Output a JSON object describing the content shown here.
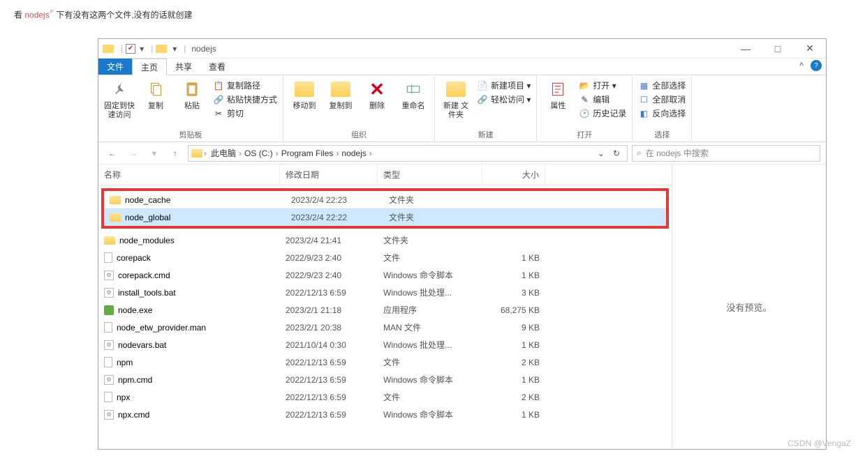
{
  "intro": {
    "pre": "看 ",
    "hl": "nodejs",
    "post": " 下有没有这两个文件,没有的话就创建"
  },
  "title": "nodejs",
  "win_controls": {
    "min": "—",
    "max": "□",
    "close": "✕"
  },
  "menubar": {
    "file": "文件",
    "home": "主页",
    "share": "共享",
    "view": "查看",
    "help": "?",
    "collapse": "^"
  },
  "ribbon": {
    "clipboard": {
      "label": "剪贴板",
      "pin": "固定到快\n速访问",
      "copy": "复制",
      "paste": "粘贴",
      "copypath": "复制路径",
      "shortcut": "粘贴快捷方式",
      "cut": "剪切"
    },
    "organize": {
      "label": "组织",
      "moveto": "移动到",
      "copyto": "复制到",
      "delete": "删除",
      "rename": "重命名"
    },
    "new": {
      "label": "新建",
      "newfolder": "新建\n文件夹",
      "newitem": "新建项目 ▾",
      "easyaccess": "轻松访问 ▾"
    },
    "open": {
      "label": "打开",
      "props": "属性",
      "open": "打开 ▾",
      "edit": "编辑",
      "history": "历史记录"
    },
    "select": {
      "label": "选择",
      "all": "全部选择",
      "none": "全部取消",
      "invert": "反向选择"
    }
  },
  "address": {
    "crumbs": [
      "此电脑",
      "OS (C:)",
      "Program Files",
      "nodejs"
    ]
  },
  "search": {
    "icon": "⌕",
    "placeholder": "在 nodejs 中搜索"
  },
  "columns": {
    "name": "名称",
    "date": "修改日期",
    "type": "类型",
    "size": "大小"
  },
  "highlighted": [
    {
      "icon": "folder",
      "name": "node_cache",
      "date": "2023/2/4 22:23",
      "type": "文件夹",
      "size": "",
      "sel": false
    },
    {
      "icon": "folder",
      "name": "node_global",
      "date": "2023/2/4 22:22",
      "type": "文件夹",
      "size": "",
      "sel": true
    }
  ],
  "files": [
    {
      "icon": "folder",
      "name": "node_modules",
      "date": "2023/2/4 21:41",
      "type": "文件夹",
      "size": ""
    },
    {
      "icon": "file",
      "name": "corepack",
      "date": "2022/9/23 2:40",
      "type": "文件",
      "size": "1 KB"
    },
    {
      "icon": "cmd",
      "name": "corepack.cmd",
      "date": "2022/9/23 2:40",
      "type": "Windows 命令脚本",
      "size": "1 KB"
    },
    {
      "icon": "cmd",
      "name": "install_tools.bat",
      "date": "2022/12/13 6:59",
      "type": "Windows 批处理...",
      "size": "3 KB"
    },
    {
      "icon": "exe",
      "name": "node.exe",
      "date": "2023/2/1 21:18",
      "type": "应用程序",
      "size": "68,275 KB"
    },
    {
      "icon": "file",
      "name": "node_etw_provider.man",
      "date": "2023/2/1 20:38",
      "type": "MAN 文件",
      "size": "9 KB"
    },
    {
      "icon": "cmd",
      "name": "nodevars.bat",
      "date": "2021/10/14 0:30",
      "type": "Windows 批处理...",
      "size": "1 KB"
    },
    {
      "icon": "file",
      "name": "npm",
      "date": "2022/12/13 6:59",
      "type": "文件",
      "size": "2 KB"
    },
    {
      "icon": "cmd",
      "name": "npm.cmd",
      "date": "2022/12/13 6:59",
      "type": "Windows 命令脚本",
      "size": "1 KB"
    },
    {
      "icon": "file",
      "name": "npx",
      "date": "2022/12/13 6:59",
      "type": "文件",
      "size": "2 KB"
    },
    {
      "icon": "cmd",
      "name": "npx.cmd",
      "date": "2022/12/13 6:59",
      "type": "Windows 命令脚本",
      "size": "1 KB"
    }
  ],
  "preview": "没有预览。",
  "watermark": "CSDN @VengaZ"
}
